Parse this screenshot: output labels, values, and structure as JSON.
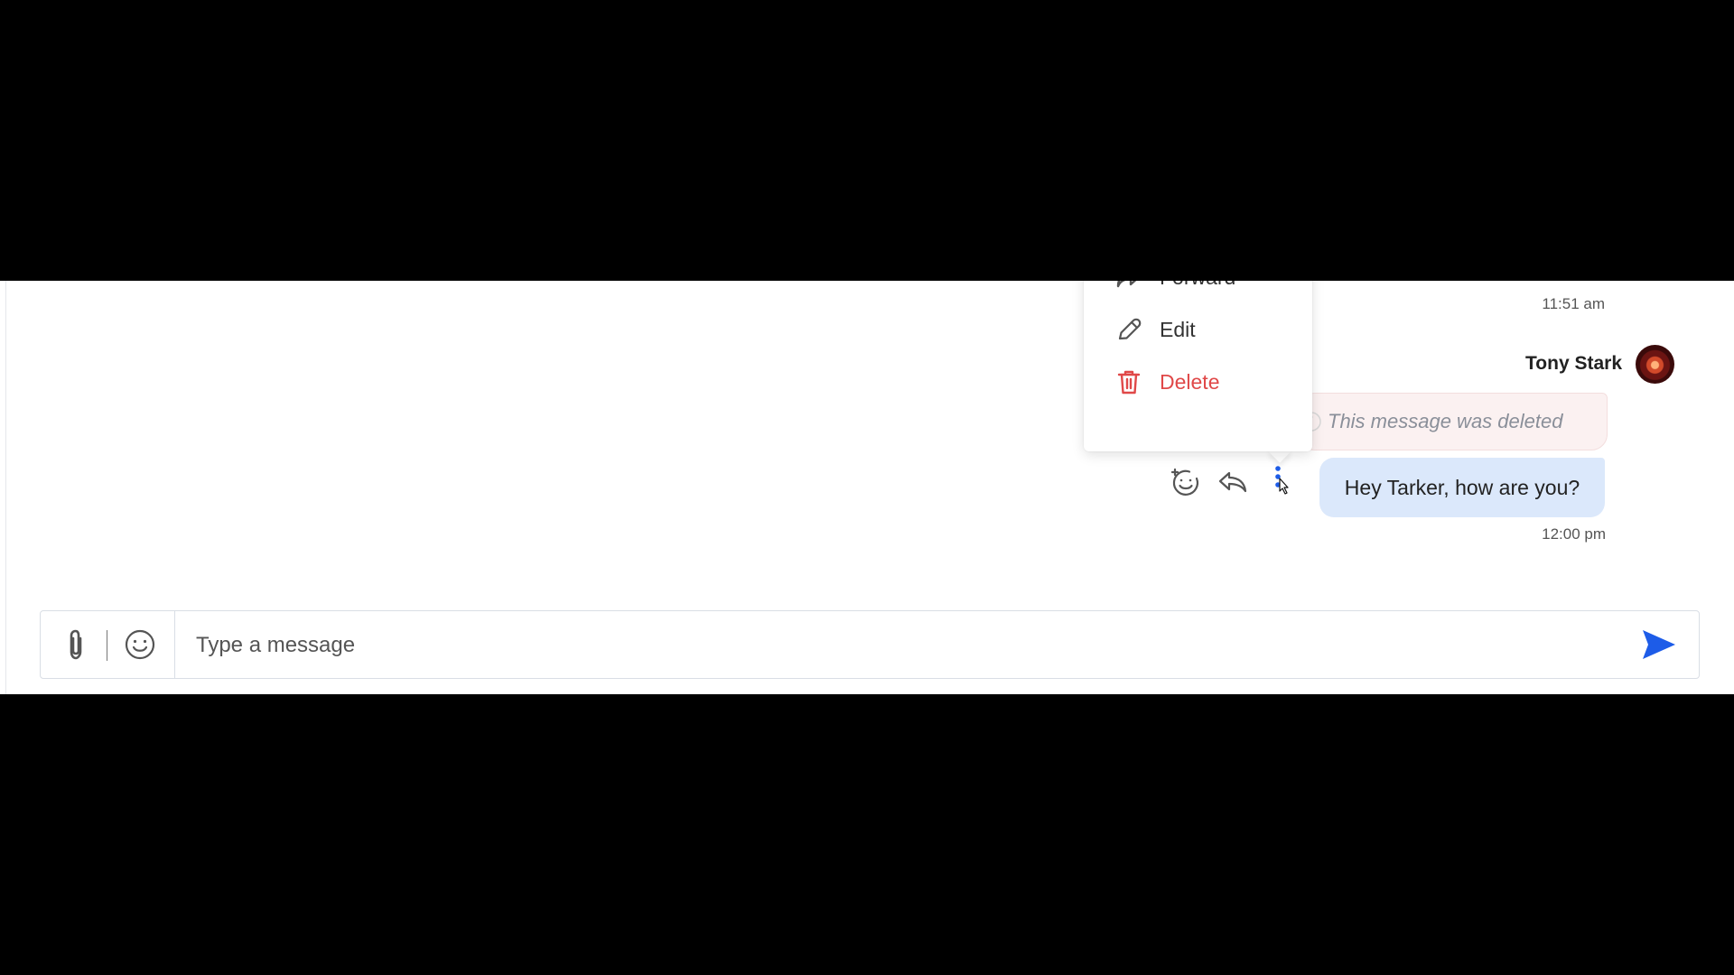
{
  "menu": {
    "items": [
      {
        "label": "Forward",
        "icon": "forward-icon"
      },
      {
        "label": "Edit",
        "icon": "pencil-icon"
      },
      {
        "label": "Delete",
        "icon": "trash-icon"
      }
    ]
  },
  "messages": {
    "prev_timestamp": "11:51 am",
    "sender": "Tony Stark",
    "deleted_text": "This message was deleted",
    "text": "Hey Tarker, how are you?",
    "timestamp": "12:00 pm"
  },
  "actions": {
    "react_icon": "add-reaction-icon",
    "reply_icon": "reply-icon",
    "more_icon": "more-vertical-icon"
  },
  "composer": {
    "placeholder": "Type a message",
    "value": "",
    "attach_icon": "paperclip-icon",
    "emoji_icon": "smiley-icon",
    "send_icon": "send-icon"
  },
  "colors": {
    "accent": "#1d5ce8",
    "delete": "#e04848",
    "bubble": "#dbe8fb",
    "deleted_bubble": "#fbf1f1"
  }
}
